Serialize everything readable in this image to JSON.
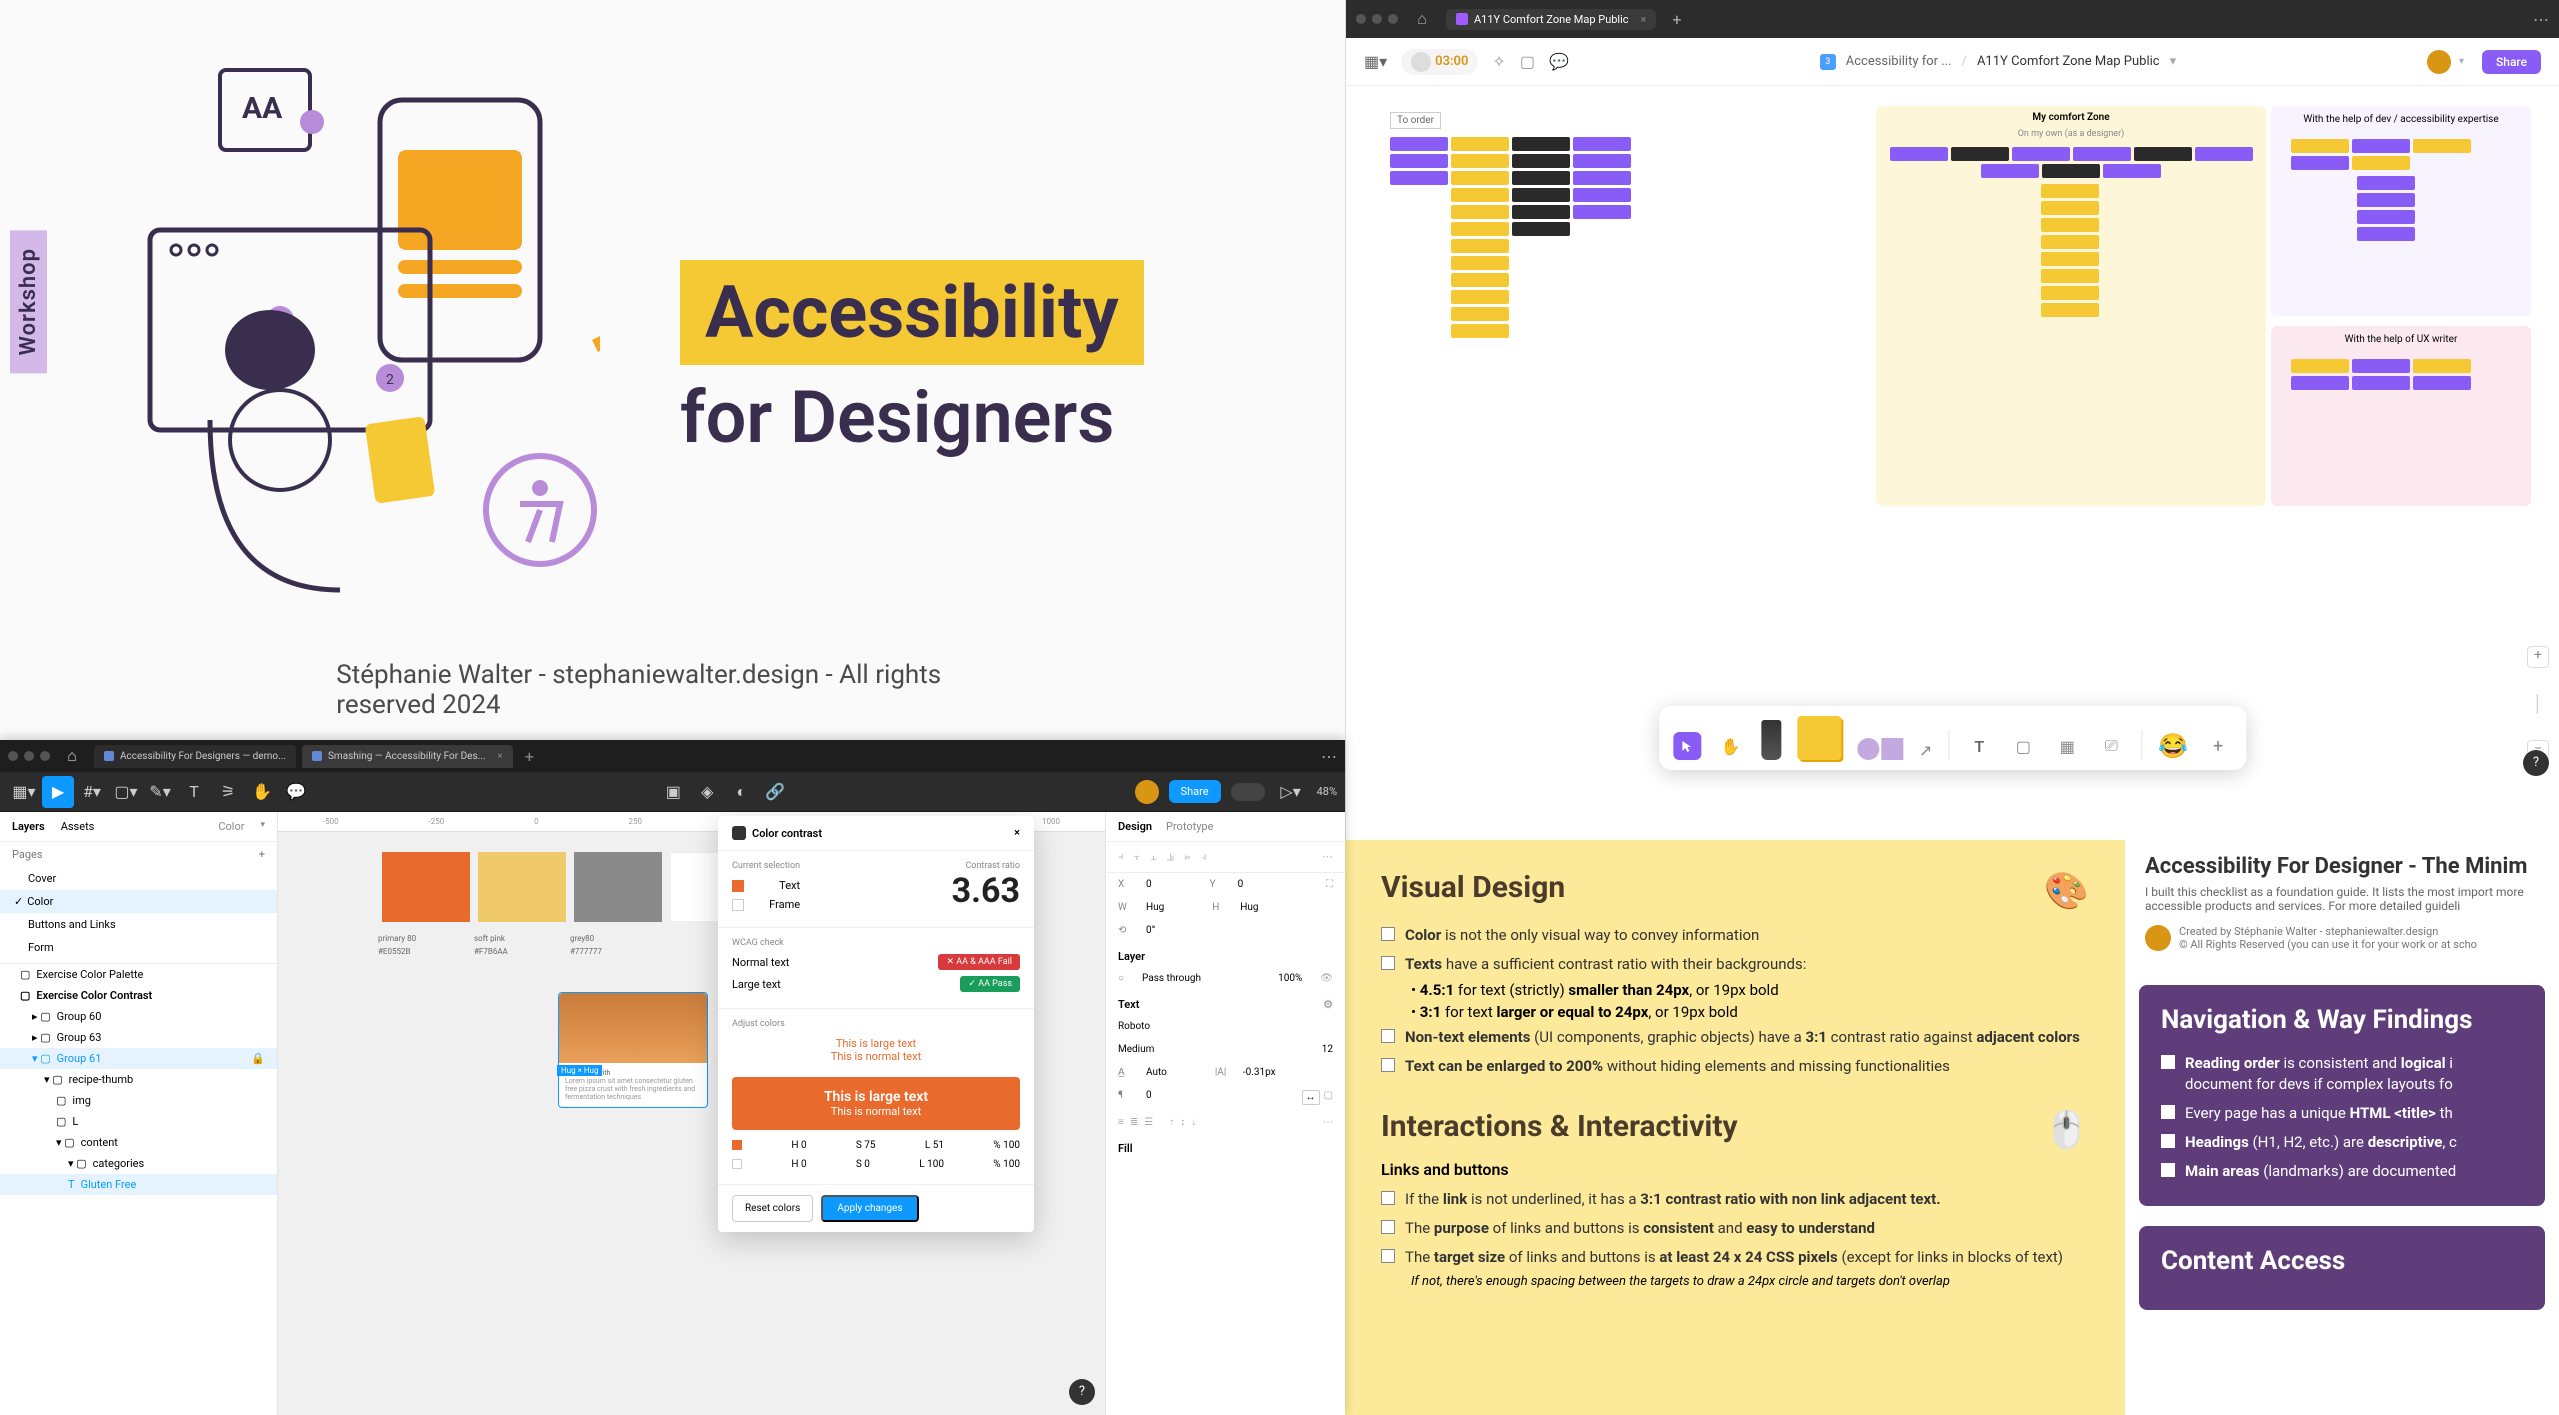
{
  "workshop": {
    "tab": "Workshop",
    "title_line1": "Accessibility",
    "title_line2": "for Designers",
    "footer": "Stéphanie Walter - stephaniewalter.design - All rights reserved 2024"
  },
  "figjam": {
    "tab_title": "A11Y Comfort Zone Map Public",
    "timer": "03:00",
    "crumb_left": "Accessibility for ...",
    "crumb_right": "A11Y Comfort Zone Map Public",
    "share": "Share",
    "sections": {
      "to_order": "To order",
      "zone_title": "My comfort Zone",
      "zone_sub": "On my own (as a designer)",
      "help_dev": "With the help of dev / accessibility expertise",
      "help_ux": "With the help of UX writer"
    }
  },
  "figma": {
    "tab1": "Accessibility For Designers — demo...",
    "tab2": "Smashing — Accessibility For Des...",
    "share": "Share",
    "zoom": "48%",
    "left_tabs": {
      "layers": "Layers",
      "assets": "Assets",
      "color": "Color"
    },
    "pages_header": "Pages",
    "pages": [
      "Cover",
      "Color",
      "Buttons and Links",
      "Form"
    ],
    "layers_top": [
      "Exercise Color Palette",
      "Exercise Color Contrast"
    ],
    "layers": [
      "Group 60",
      "Group 63",
      "Group 61",
      "recipe-thumb",
      "img",
      "L",
      "content",
      "categories",
      "Gluten Free"
    ],
    "right_tabs": {
      "design": "Design",
      "proto": "Prototype"
    },
    "props": {
      "x": "0",
      "y": "0",
      "w": "Hug",
      "h": "Hug",
      "rot": "0°"
    },
    "layer_section": "Layer",
    "pass_through": "Pass through",
    "opacity": "100%",
    "text_section": "Text",
    "font": "Roboto",
    "weight": "Medium",
    "size": "12",
    "lh_auto": "Auto",
    "letter": "-0.31px",
    "para": "0",
    "fill_section": "Fill",
    "swatches": [
      {
        "name": "primary 80",
        "hex": "#E0552B"
      },
      {
        "name": "soft pink",
        "hex": "#F7B6AA"
      },
      {
        "name": "grey80",
        "hex": "#777777"
      }
    ]
  },
  "contrast": {
    "title": "Color contrast",
    "current": "Current selection",
    "ratio_label": "Contrast ratio",
    "ratio": "3.63",
    "text": "Text",
    "frame": "Frame",
    "wcag": "WCAG check",
    "normal": "Normal text",
    "large": "Large text",
    "fail": "AA & AAA Fail",
    "pass": "AA Pass",
    "adjust": "Adjust colors",
    "preview_lg": "This is large text",
    "preview_nm": "This is normal text",
    "reset": "Reset colors",
    "apply": "Apply changes",
    "hsl": {
      "h": "0",
      "s": "75",
      "l": "51",
      "pct": "100",
      "h2": "0",
      "s2": "0",
      "l2": "100",
      "pct2": "100"
    }
  },
  "checklist": {
    "title_right": "Accessibility For Designer - The Minim",
    "intro": "I built this checklist as a foundation guide. It lists the most import\nmore accessible products and services. For more detailed guideli",
    "author": "Created by Stéphanie Walter - stephaniewalter.design",
    "rights": "© All Rights Reserved (you can use it for your work or at scho",
    "vd_head": "Visual Design",
    "vd_items": [
      "Color is not the only visual way to convey information",
      "Texts have a sufficient contrast ratio with their backgrounds:"
    ],
    "vd_sub": [
      "4.5:1 for text (strictly) smaller than 24px, or 19px bold",
      "3:1 for text larger or equal to 24px, or 19px bold"
    ],
    "vd_items2": [
      "Non-text elements (UI components, graphic objects) have a 3:1 contrast ratio against adjacent colors",
      "Text can be enlarged to 200% without hiding elements and missing functionalities"
    ],
    "ii_head": "Interactions & Interactivity",
    "ii_sub": "Links and buttons",
    "ii_items": [
      "If the link is not underlined, it has a 3:1 contrast ratio with non link adjacent text.",
      "The purpose of links and buttons is consistent and easy to understand",
      "The target size of links and buttons is at least 24 x 24 CSS pixels (except for links in blocks of text)"
    ],
    "ii_note": "If not, there's enough spacing between the targets to draw a 24px circle and targets don't overlap",
    "nav_head": "Navigation & Way Findings",
    "nav_items": [
      "Reading order is consistent and logical i document for devs if complex layouts for",
      "Every page has a unique HTML <title> th",
      "Headings (H1, H2, etc.) are descriptive, c",
      "Main areas (landmarks) are documented"
    ],
    "content_head": "Content Access"
  }
}
